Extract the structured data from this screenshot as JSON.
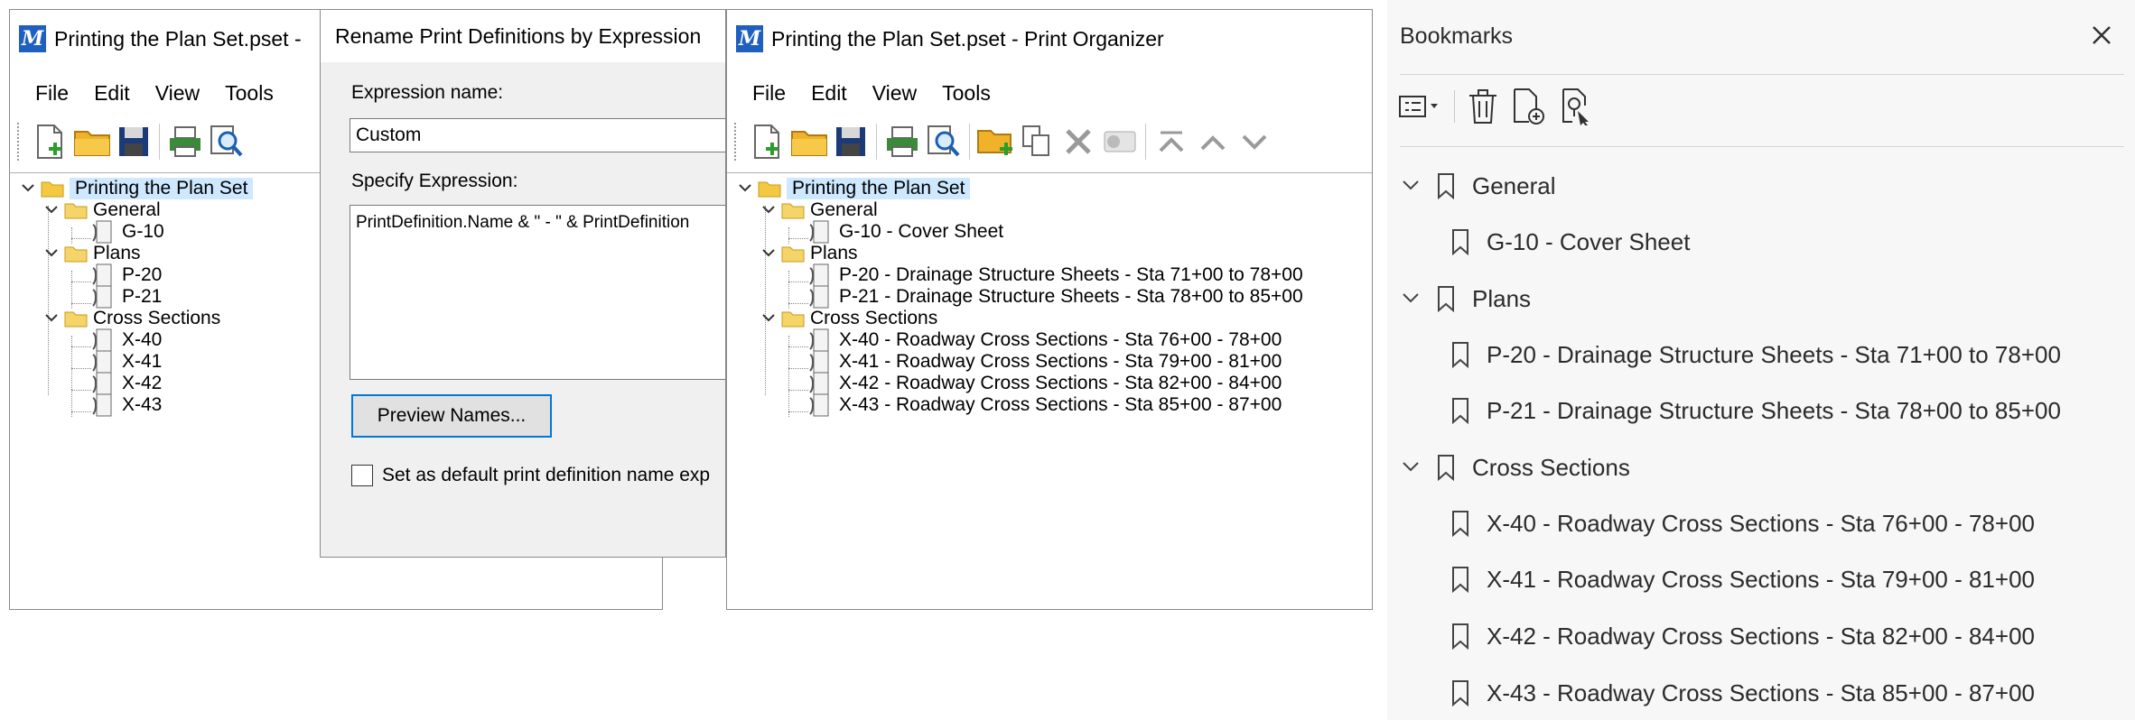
{
  "window_left": {
    "title": "Printing the Plan Set.pset -",
    "menu": [
      "File",
      "Edit",
      "View",
      "Tools"
    ],
    "tree": {
      "root": "Printing the Plan Set",
      "groups": [
        {
          "label": "General",
          "items": [
            "G-10"
          ]
        },
        {
          "label": "Plans",
          "items": [
            "P-20",
            "P-21"
          ]
        },
        {
          "label": "Cross Sections",
          "items": [
            "X-40",
            "X-41",
            "X-42",
            "X-43"
          ]
        }
      ]
    }
  },
  "dialog": {
    "title": "Rename Print Definitions by Expression",
    "expression_name_label": "Expression name:",
    "expression_name_value": "Custom",
    "specify_label": "Specify Expression:",
    "expression_text": "PrintDefinition.Name & \" - \" & PrintDefinition",
    "preview_button": "Preview Names...",
    "default_checkbox_label": "Set as default print definition name exp"
  },
  "window_right": {
    "title": "Printing the Plan Set.pset - Print Organizer",
    "menu": [
      "File",
      "Edit",
      "View",
      "Tools"
    ],
    "tree": {
      "root": "Printing the Plan Set",
      "groups": [
        {
          "label": "General",
          "items": [
            "G-10 - Cover Sheet"
          ]
        },
        {
          "label": "Plans",
          "items": [
            "P-20 - Drainage Structure Sheets - Sta 71+00 to 78+00",
            "P-21 - Drainage Structure Sheets - Sta 78+00 to 85+00"
          ]
        },
        {
          "label": "Cross Sections",
          "items": [
            "X-40 - Roadway Cross Sections - Sta 76+00 - 78+00",
            "X-41 - Roadway Cross Sections - Sta 79+00 - 81+00",
            "X-42 - Roadway Cross Sections - Sta 82+00 - 84+00",
            "X-43 - Roadway Cross Sections - Sta 85+00 - 87+00"
          ]
        }
      ]
    }
  },
  "bookmarks": {
    "title": "Bookmarks",
    "groups": [
      {
        "label": "General",
        "items": [
          "G-10 - Cover Sheet"
        ]
      },
      {
        "label": "Plans",
        "items": [
          "P-20 - Drainage Structure Sheets - Sta 71+00 to 78+00",
          "P-21 - Drainage Structure Sheets - Sta 78+00 to 85+00"
        ]
      },
      {
        "label": "Cross Sections",
        "items": [
          "X-40 - Roadway Cross Sections - Sta 76+00 - 78+00",
          "X-41 - Roadway Cross Sections - Sta 79+00 - 81+00",
          "X-42 - Roadway Cross Sections - Sta 82+00 - 84+00",
          "X-43 - Roadway Cross Sections - Sta 85+00 - 87+00"
        ]
      }
    ]
  },
  "colors": {
    "selection": "#cde8ff",
    "accent": "#0078d7",
    "folder": "#f5c842",
    "app_icon": "#1f5fbf",
    "panel_bg": "#f7f7f7"
  },
  "icons": {
    "toolbar": [
      "new-icon",
      "open-folder-icon",
      "save-icon",
      "print-icon",
      "print-preview-icon",
      "add-folder-icon",
      "copy-icon",
      "delete-icon",
      "properties-icon",
      "move-top-icon",
      "move-up-icon",
      "move-down-icon"
    ],
    "bookmarks_toolbar": [
      "options-menu-icon",
      "delete-bookmark-icon",
      "add-bookmark-icon",
      "find-bookmark-icon"
    ]
  }
}
